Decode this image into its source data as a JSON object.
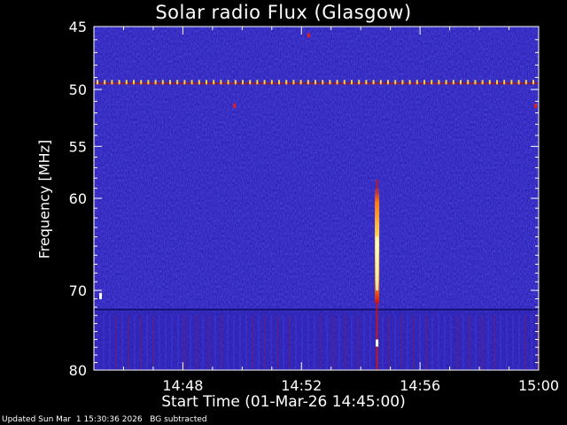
{
  "chart_data": {
    "type": "heatmap",
    "title": "Solar radio Flux (Glasgow)",
    "ylabel": "Frequency [MHz]",
    "xlabel": "Start Time (01-Mar-26 14:45:00)",
    "x_ticks": [
      "14:48",
      "14:52",
      "14:56",
      "15:00"
    ],
    "x_tick_minutes": [
      3,
      7,
      11,
      15
    ],
    "x_range_minutes": [
      0,
      15
    ],
    "y_ticks": [
      45,
      50,
      55,
      60,
      70,
      80
    ],
    "ylim": [
      45,
      80
    ],
    "y_scale": "log",
    "colormap": [
      "#1a1aa0",
      "#3a2fd0",
      "#b0141e",
      "#ff6010",
      "#ffff60"
    ],
    "events": [
      {
        "type": "burst",
        "time_minutes": 9.55,
        "freq_start": 59,
        "freq_end": 80
      },
      {
        "type": "interference_line",
        "freq": 49.5
      }
    ]
  },
  "footer": {
    "updated": "Updated Sun Mar  1 15:30:36 2026",
    "note": "BG subtracted"
  }
}
